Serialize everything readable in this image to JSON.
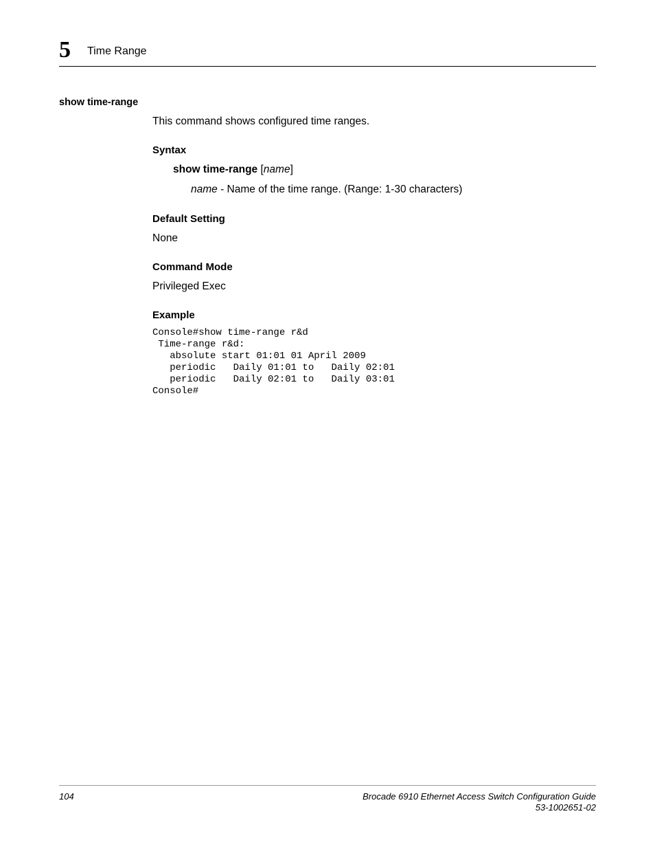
{
  "header": {
    "chapter_number": "5",
    "section_title": "Time Range"
  },
  "command": {
    "name": "show time-range",
    "intro": "This command shows configured time ranges.",
    "syntax": {
      "heading": "Syntax",
      "command": "show time-range",
      "arg": "name",
      "param_name": "name",
      "param_desc": " - Name of the time range. (Range: 1-30 characters)"
    },
    "default_setting": {
      "heading": "Default Setting",
      "value": "None"
    },
    "command_mode": {
      "heading": "Command Mode",
      "value": "Privileged Exec"
    },
    "example": {
      "heading": "Example",
      "output": "Console#show time-range r&d\n Time-range r&d:\n   absolute start 01:01 01 April 2009\n   periodic   Daily 01:01 to   Daily 02:01\n   periodic   Daily 02:01 to   Daily 03:01\nConsole#"
    }
  },
  "footer": {
    "page_number": "104",
    "doc_title": "Brocade 6910 Ethernet Access Switch Configuration Guide",
    "doc_number": "53-1002651-02"
  }
}
